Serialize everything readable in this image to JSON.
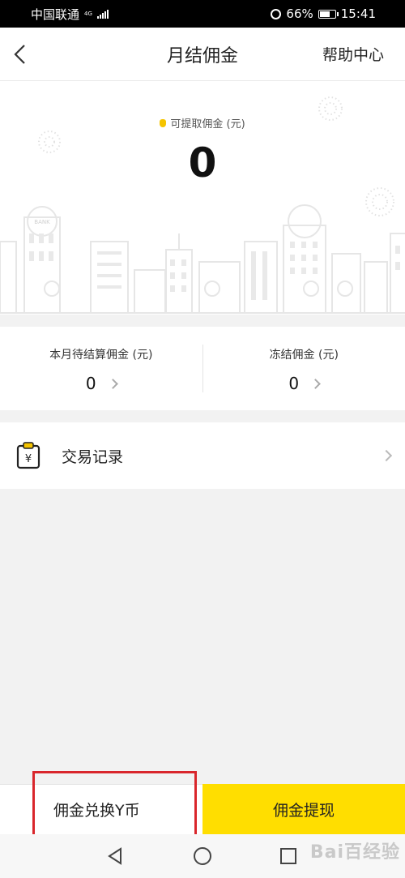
{
  "status_bar": {
    "carrier": "中国联通",
    "network": "4G",
    "battery": "66%",
    "time": "15:41"
  },
  "nav": {
    "title": "月结佣金",
    "help": "帮助中心"
  },
  "hero": {
    "label": "可提取佣金 (元)",
    "amount": "0",
    "bank_sign": "BANK"
  },
  "stats": [
    {
      "label": "本月待结算佣金 (元)",
      "value": "0"
    },
    {
      "label": "冻结佣金 (元)",
      "value": "0"
    }
  ],
  "records": {
    "label": "交易记录",
    "icon_glyph": "¥"
  },
  "bottom": {
    "exchange": "佣金兑换Y币",
    "withdraw": "佣金提现"
  },
  "watermark": "Bai百经验",
  "colors": {
    "accent_yellow": "#ffde00",
    "highlight_red": "#d9262c"
  }
}
